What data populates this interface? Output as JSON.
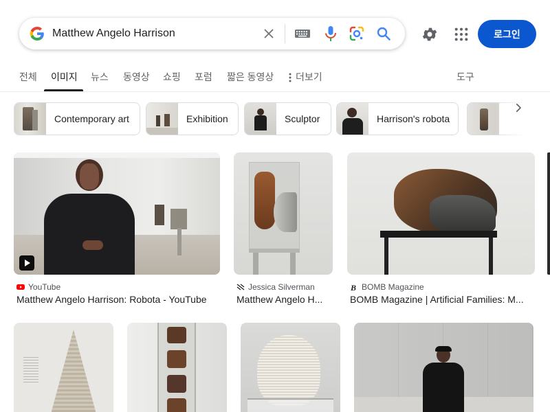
{
  "search": {
    "query": "Matthew Angelo Harrison",
    "clear_icon": "close-icon",
    "keyboard_icon": "keyboard-icon",
    "mic_icon": "microphone-icon",
    "lens_icon": "google-lens-icon",
    "search_icon": "search-icon"
  },
  "header": {
    "settings_icon": "gear-icon",
    "apps_icon": "apps-grid-icon",
    "login_label": "로그인"
  },
  "tabs": [
    {
      "label": "전체"
    },
    {
      "label": "이미지",
      "active": true
    },
    {
      "label": "뉴스"
    },
    {
      "label": "동영상"
    },
    {
      "label": "쇼핑"
    },
    {
      "label": "포럼"
    },
    {
      "label": "짧은 동영상"
    },
    {
      "label": "더보기"
    }
  ],
  "tools_label": "도구",
  "chips": [
    {
      "label": "Contemporary art"
    },
    {
      "label": "Exhibition"
    },
    {
      "label": "Sculptor"
    },
    {
      "label": "Harrison's robota"
    }
  ],
  "results": [
    {
      "source": "YouTube",
      "title": "Matthew Angelo Harrison: Robota - YouTube"
    },
    {
      "source": "Jessica Silverman",
      "title": "Matthew Angelo H..."
    },
    {
      "source": "BOMB Magazine",
      "title": "BOMB Magazine | Artificial Families: M..."
    }
  ],
  "colors": {
    "login_bg": "#0b57d0",
    "youtube_red": "#ff0000",
    "tab_active": "#202124",
    "tab_inactive": "#5f6368"
  }
}
